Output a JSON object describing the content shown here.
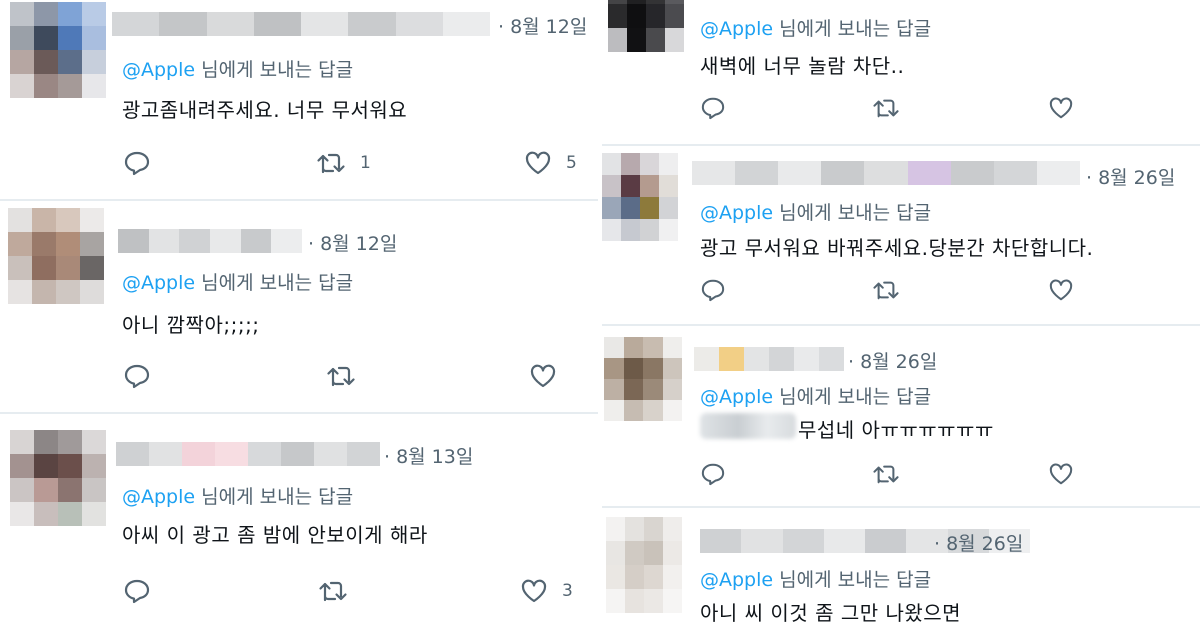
{
  "ui": {
    "reply_prefix": "@Apple",
    "reply_suffix": "님에게 보내는 답글",
    "colors": {
      "mention": "#1da1f2",
      "muted": "#536471",
      "text": "#0f1419",
      "divider": "#e6ecf0"
    },
    "icons": [
      "reply-icon",
      "retweet-icon",
      "like-icon"
    ]
  },
  "left_column": [
    {
      "date": "· 8월 12일",
      "text": "광고좀내려주세요. 너무 무서워요",
      "retweets": "1",
      "likes": "5"
    },
    {
      "date": "· 8월 12일",
      "text": "아니 깜짝아;;;;;",
      "retweets": "",
      "likes": ""
    },
    {
      "date": "· 8월 13일",
      "text": "아씨 이 광고 좀 밤에 안보이게 해라",
      "retweets": "",
      "likes": "3"
    }
  ],
  "right_column": [
    {
      "date": "",
      "text": "새벽에 너무 놀람 차단..",
      "retweets": "",
      "likes": ""
    },
    {
      "date": "· 8월 26일",
      "text": "광고 무서워요 바꿔주세요.당분간 차단합니다.",
      "retweets": "",
      "likes": ""
    },
    {
      "date": "· 8월 26일",
      "text": "무섭네 아ㅠㅠㅠㅠㅠㅠ",
      "retweets": "",
      "likes": ""
    },
    {
      "date": "· 8월 26일",
      "text": "아니 씨 이것 좀 그만 나왔으면",
      "retweets": "",
      "likes": ""
    }
  ]
}
